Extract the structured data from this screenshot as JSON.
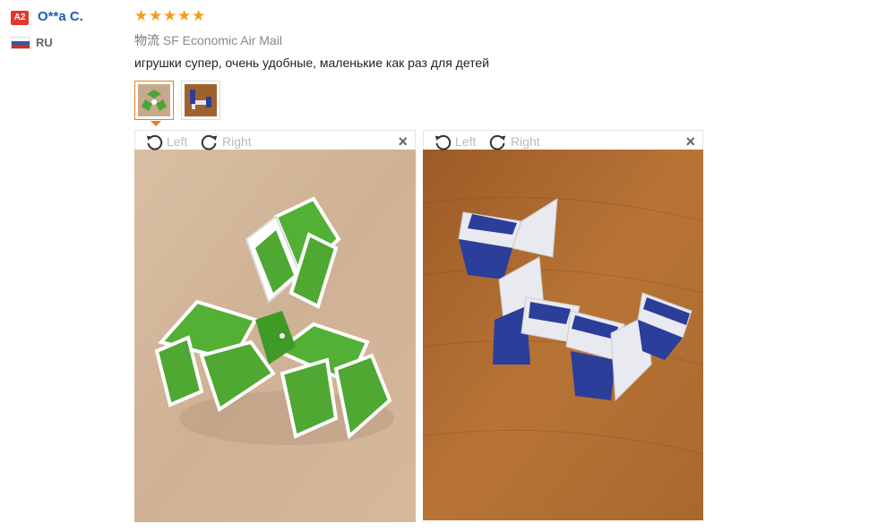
{
  "user": {
    "level_badge": "A2",
    "name": "O**a C.",
    "country_code": "RU"
  },
  "review": {
    "stars": 5,
    "logistics_prefix": "物流",
    "logistics_name": "SF Economic Air Mail",
    "text": "игрушки супер, очень удобные, маленькие как раз для детей",
    "thumbnails": [
      {
        "name": "green-snake-puzzle",
        "active": true
      },
      {
        "name": "blue-snake-puzzle",
        "active": false
      }
    ]
  },
  "viewers": [
    {
      "left_label": "Left",
      "right_label": "Right",
      "close": "×",
      "photo": "green-snake-puzzle"
    },
    {
      "left_label": "Left",
      "right_label": "Right",
      "close": "×",
      "photo": "blue-snake-puzzle"
    }
  ],
  "colors": {
    "accent": "#e67e22",
    "star": "#f39c1a",
    "badge": "#e4372b",
    "link": "#1a5fb4"
  }
}
